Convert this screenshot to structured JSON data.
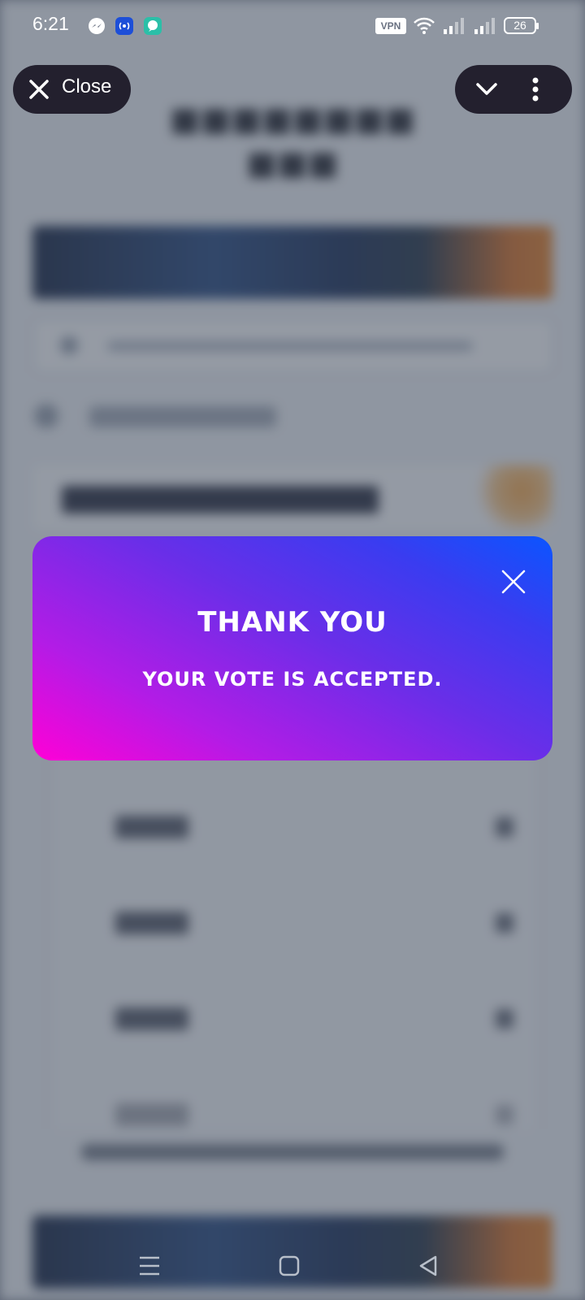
{
  "status_bar": {
    "time": "6:21",
    "vpn_label": "VPN",
    "battery_level": "26",
    "notification_icons": [
      "messenger-icon",
      "broadcast-icon",
      "chat-icon"
    ],
    "system_icons": [
      "wifi-icon",
      "signal-icon",
      "signal-icon",
      "battery-icon"
    ]
  },
  "top_bar": {
    "close_label": "Close",
    "menu_icons": [
      "chevron-down-icon",
      "more-vert-icon"
    ]
  },
  "dialog": {
    "title": "THANK YOU",
    "message": "YOUR VOTE IS ACCEPTED.",
    "gradient_colors": [
      "#ff00d6",
      "#6a2ee8",
      "#0b55ff"
    ]
  },
  "navigation_bar": {
    "buttons": [
      "menu-icon",
      "home-icon",
      "back-icon"
    ]
  }
}
